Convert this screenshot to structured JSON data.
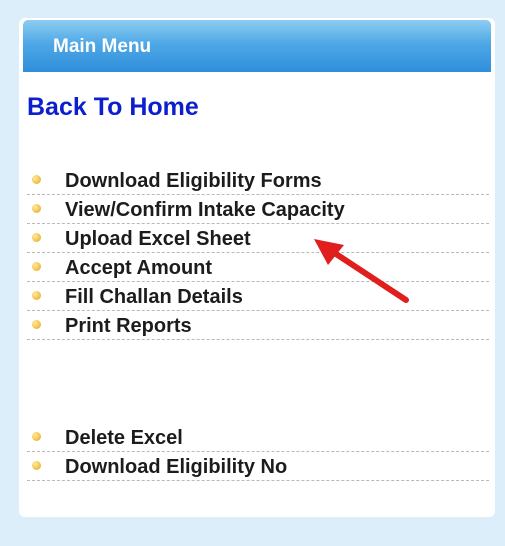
{
  "menu": {
    "header_title": "Main Menu",
    "back_link": "Back To Home",
    "groups": [
      {
        "items": [
          {
            "label": "Download Eligibility Forms"
          },
          {
            "label": "View/Confirm Intake Capacity"
          },
          {
            "label": "Upload Excel Sheet"
          },
          {
            "label": "Accept Amount"
          },
          {
            "label": "Fill Challan Details"
          },
          {
            "label": "Print Reports"
          }
        ]
      },
      {
        "items": [
          {
            "label": "Delete Excel"
          },
          {
            "label": "Download Eligibility No"
          }
        ]
      }
    ]
  },
  "annotation": {
    "type": "arrow",
    "color": "#e01e1e",
    "points_to": "Upload Excel Sheet"
  },
  "colors": {
    "background": "#dbeef9",
    "header_gradient_top": "#8ccdf2",
    "header_gradient_bottom": "#2f8fdb",
    "back_link": "#0b1fcc",
    "bullet": "#f3c54f"
  }
}
